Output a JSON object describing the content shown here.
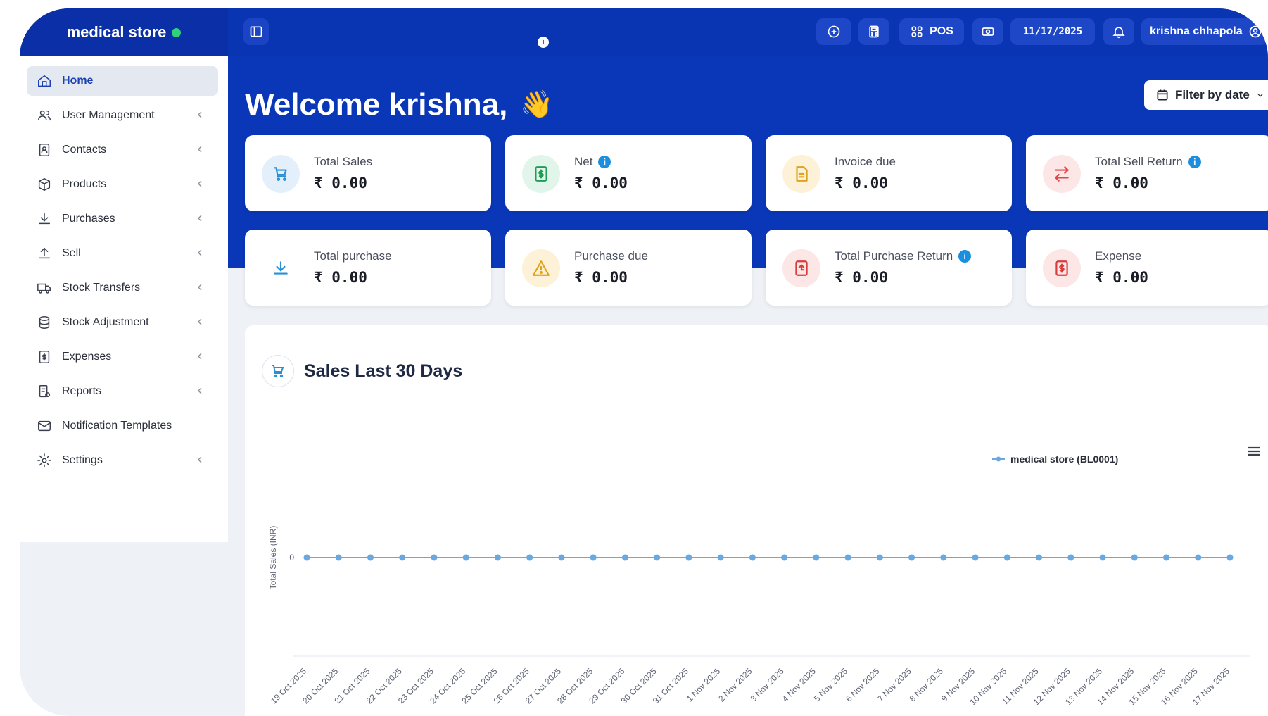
{
  "brand": {
    "name": "medical store",
    "status_color": "#2fd17a"
  },
  "topbar": {
    "pos_label": "POS",
    "date": "11/17/2025",
    "user": "krishna chhapola"
  },
  "sidebar": {
    "items": [
      {
        "label": "Home",
        "icon": "home-icon",
        "active": true,
        "chevron": false
      },
      {
        "label": "User Management",
        "icon": "users-icon",
        "chevron": true
      },
      {
        "label": "Contacts",
        "icon": "contacts-icon",
        "chevron": true
      },
      {
        "label": "Products",
        "icon": "box-icon",
        "chevron": true
      },
      {
        "label": "Purchases",
        "icon": "download-icon",
        "chevron": true
      },
      {
        "label": "Sell",
        "icon": "upload-icon",
        "chevron": true
      },
      {
        "label": "Stock Transfers",
        "icon": "truck-icon",
        "chevron": true
      },
      {
        "label": "Stock Adjustment",
        "icon": "database-icon",
        "chevron": true
      },
      {
        "label": "Expenses",
        "icon": "money-icon",
        "chevron": true
      },
      {
        "label": "Reports",
        "icon": "report-icon",
        "chevron": true
      },
      {
        "label": "Notification Templates",
        "icon": "envelope-icon",
        "chevron": false
      },
      {
        "label": "Settings",
        "icon": "gear-icon",
        "chevron": true
      }
    ]
  },
  "main": {
    "welcome": "Welcome krishna,",
    "wave": "👋",
    "filter_label": "Filter by date",
    "cards": [
      {
        "label": "Total Sales",
        "value": "₹ 0.00",
        "info": false,
        "icon": "cart-icon",
        "tint": "#e3f0fb",
        "color": "#2b8fd6"
      },
      {
        "label": "Net",
        "value": "₹ 0.00",
        "info": true,
        "icon": "cash-icon",
        "tint": "#e2f5ea",
        "color": "#1f9d55"
      },
      {
        "label": "Invoice due",
        "value": "₹ 0.00",
        "info": false,
        "icon": "invoice-icon",
        "tint": "#fdf1d8",
        "color": "#e0a21a"
      },
      {
        "label": "Total Sell Return",
        "value": "₹ 0.00",
        "info": true,
        "icon": "exchange-icon",
        "tint": "#fde6e6",
        "color": "#e04848"
      },
      {
        "label": "Total purchase",
        "value": "₹ 0.00",
        "info": false,
        "icon": "download-icon",
        "tint": "#ffffff",
        "color": "#2b8fd6"
      },
      {
        "label": "Purchase due",
        "value": "₹ 0.00",
        "info": false,
        "icon": "warning-icon",
        "tint": "#fdf1d8",
        "color": "#e0a21a"
      },
      {
        "label": "Total Purchase Return",
        "value": "₹ 0.00",
        "info": true,
        "icon": "return-icon",
        "tint": "#fde6e6",
        "color": "#d83c3c"
      },
      {
        "label": "Expense",
        "value": "₹ 0.00",
        "info": false,
        "icon": "money-icon",
        "tint": "#fde6e6",
        "color": "#d83c3c"
      }
    ],
    "chart_title": "Sales Last 30 Days"
  },
  "chart_data": {
    "type": "line",
    "title": "Sales Last 30 Days",
    "xlabel": "",
    "ylabel": "Total Sales (INR)",
    "categories": [
      "19 Oct 2025",
      "20 Oct 2025",
      "21 Oct 2025",
      "22 Oct 2025",
      "23 Oct 2025",
      "24 Oct 2025",
      "25 Oct 2025",
      "26 Oct 2025",
      "27 Oct 2025",
      "28 Oct 2025",
      "29 Oct 2025",
      "30 Oct 2025",
      "31 Oct 2025",
      "1 Nov 2025",
      "2 Nov 2025",
      "3 Nov 2025",
      "4 Nov 2025",
      "5 Nov 2025",
      "6 Nov 2025",
      "7 Nov 2025",
      "8 Nov 2025",
      "9 Nov 2025",
      "10 Nov 2025",
      "11 Nov 2025",
      "12 Nov 2025",
      "13 Nov 2025",
      "14 Nov 2025",
      "15 Nov 2025",
      "16 Nov 2025",
      "17 Nov 2025"
    ],
    "series": [
      {
        "name": "medical store (BL0001)",
        "color": "#6aa9e0",
        "values": [
          0,
          0,
          0,
          0,
          0,
          0,
          0,
          0,
          0,
          0,
          0,
          0,
          0,
          0,
          0,
          0,
          0,
          0,
          0,
          0,
          0,
          0,
          0,
          0,
          0,
          0,
          0,
          0,
          0,
          0
        ]
      }
    ],
    "yticks": [
      "0"
    ],
    "legend": "top-right",
    "grid": false
  }
}
